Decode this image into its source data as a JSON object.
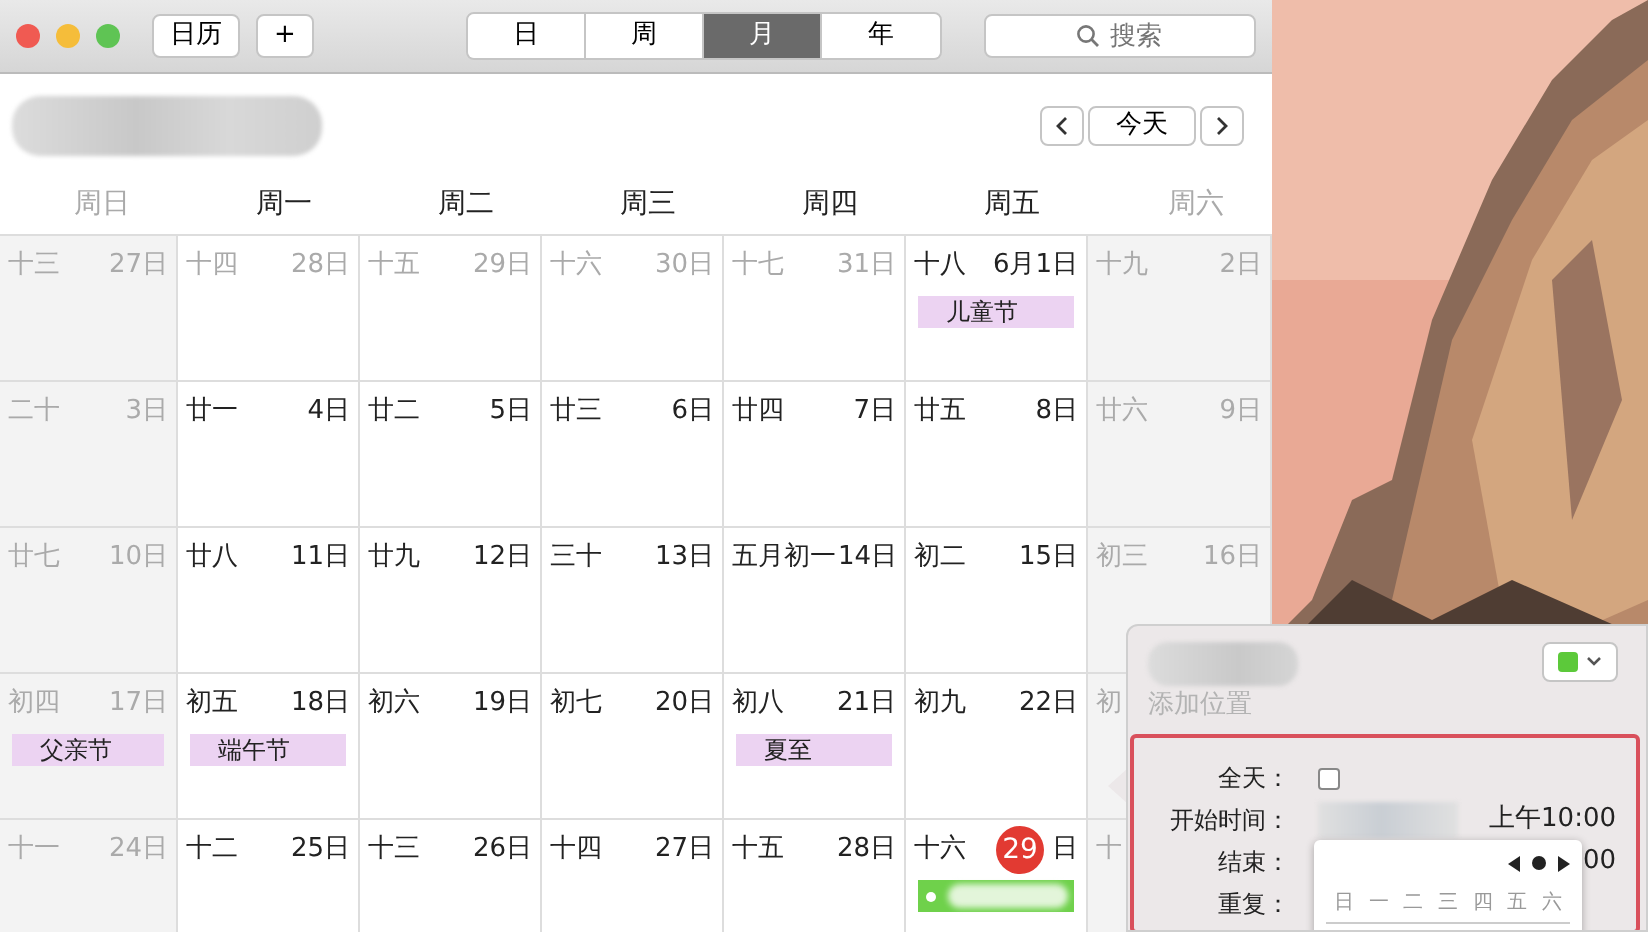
{
  "toolbar": {
    "buttons": [
      "日历",
      "+"
    ],
    "view_tabs": [
      {
        "label": "日",
        "selected": false
      },
      {
        "label": "周",
        "selected": false
      },
      {
        "label": "月",
        "selected": true
      },
      {
        "label": "年",
        "selected": false
      }
    ],
    "search": {
      "placeholder": "搜索"
    }
  },
  "nav": {
    "today": "今天"
  },
  "weekdays": [
    {
      "label": "周日",
      "weekend": true
    },
    {
      "label": "周一",
      "weekend": false
    },
    {
      "label": "周二",
      "weekend": false
    },
    {
      "label": "周三",
      "weekend": false
    },
    {
      "label": "周四",
      "weekend": false
    },
    {
      "label": "周五",
      "weekend": false
    },
    {
      "label": "周六",
      "weekend": true
    }
  ],
  "weeks": [
    [
      {
        "lunar": "十三",
        "day": "27日",
        "muted": true,
        "weekend": true
      },
      {
        "lunar": "十四",
        "day": "28日",
        "muted": true,
        "weekend": false
      },
      {
        "lunar": "十五",
        "day": "29日",
        "muted": true,
        "weekend": false
      },
      {
        "lunar": "十六",
        "day": "30日",
        "muted": true,
        "weekend": false
      },
      {
        "lunar": "十七",
        "day": "31日",
        "muted": true,
        "weekend": false
      },
      {
        "lunar": "十八",
        "day": "6月1日",
        "muted": false,
        "weekend": false,
        "events": [
          {
            "title": "儿童节",
            "color": "#ecd3f2",
            "kind": "holiday"
          }
        ]
      },
      {
        "lunar": "十九",
        "day": "2日",
        "muted": true,
        "weekend": true
      }
    ],
    [
      {
        "lunar": "二十",
        "day": "3日",
        "muted": true,
        "weekend": true
      },
      {
        "lunar": "廿一",
        "day": "4日",
        "muted": false,
        "weekend": false
      },
      {
        "lunar": "廿二",
        "day": "5日",
        "muted": false,
        "weekend": false
      },
      {
        "lunar": "廿三",
        "day": "6日",
        "muted": false,
        "weekend": false
      },
      {
        "lunar": "廿四",
        "day": "7日",
        "muted": false,
        "weekend": false
      },
      {
        "lunar": "廿五",
        "day": "8日",
        "muted": false,
        "weekend": false
      },
      {
        "lunar": "廿六",
        "day": "9日",
        "muted": true,
        "weekend": true
      }
    ],
    [
      {
        "lunar": "廿七",
        "day": "10日",
        "muted": true,
        "weekend": true
      },
      {
        "lunar": "廿八",
        "day": "11日",
        "muted": false,
        "weekend": false
      },
      {
        "lunar": "廿九",
        "day": "12日",
        "muted": false,
        "weekend": false
      },
      {
        "lunar": "三十",
        "day": "13日",
        "muted": false,
        "weekend": false
      },
      {
        "lunar": "五月初一",
        "day": "14日",
        "muted": false,
        "weekend": false
      },
      {
        "lunar": "初二",
        "day": "15日",
        "muted": false,
        "weekend": false
      },
      {
        "lunar": "初三",
        "day": "16日",
        "muted": true,
        "weekend": true
      }
    ],
    [
      {
        "lunar": "初四",
        "day": "17日",
        "muted": true,
        "weekend": true,
        "events": [
          {
            "title": "父亲节",
            "color": "#ecd3f2",
            "kind": "holiday"
          }
        ]
      },
      {
        "lunar": "初五",
        "day": "18日",
        "muted": false,
        "weekend": false,
        "events": [
          {
            "title": "端午节",
            "color": "#ecd3f2",
            "kind": "holiday"
          }
        ]
      },
      {
        "lunar": "初六",
        "day": "19日",
        "muted": false,
        "weekend": false
      },
      {
        "lunar": "初七",
        "day": "20日",
        "muted": false,
        "weekend": false
      },
      {
        "lunar": "初八",
        "day": "21日",
        "muted": false,
        "weekend": false,
        "events": [
          {
            "title": "夏至",
            "color": "#ecd3f2",
            "kind": "holiday"
          }
        ]
      },
      {
        "lunar": "初九",
        "day": "22日",
        "muted": false,
        "weekend": false
      },
      {
        "lunar": "初",
        "muted": true,
        "weekend": true
      }
    ],
    [
      {
        "lunar": "十一",
        "day": "24日",
        "muted": true,
        "weekend": true
      },
      {
        "lunar": "十二",
        "day": "25日",
        "muted": false,
        "weekend": false
      },
      {
        "lunar": "十三",
        "day": "26日",
        "muted": false,
        "weekend": false
      },
      {
        "lunar": "十四",
        "day": "27日",
        "muted": false,
        "weekend": false
      },
      {
        "lunar": "十五",
        "day": "28日",
        "muted": false,
        "weekend": false
      },
      {
        "lunar": "十六",
        "day": "29",
        "today": true,
        "suffix": "日",
        "muted": false,
        "weekend": false,
        "events": [
          {
            "color": "#6fd14b",
            "kind": "blurred"
          }
        ]
      },
      {
        "lunar": "十",
        "muted": true,
        "weekend": true
      }
    ]
  ],
  "popover": {
    "location_placeholder": "添加位置",
    "color": "#5cc93a",
    "fields": [
      {
        "label": "全天：",
        "kind": "checkbox",
        "checked": false
      },
      {
        "label": "开始时间：",
        "kind": "datetime",
        "time": "上午10:00"
      },
      {
        "label": "结束：",
        "kind": "time",
        "time": "00"
      },
      {
        "label": "重复：",
        "kind": "plain"
      }
    ],
    "mini_calendar": {
      "weekdays": [
        "日",
        "一",
        "二",
        "三",
        "四",
        "五",
        "六"
      ]
    }
  }
}
